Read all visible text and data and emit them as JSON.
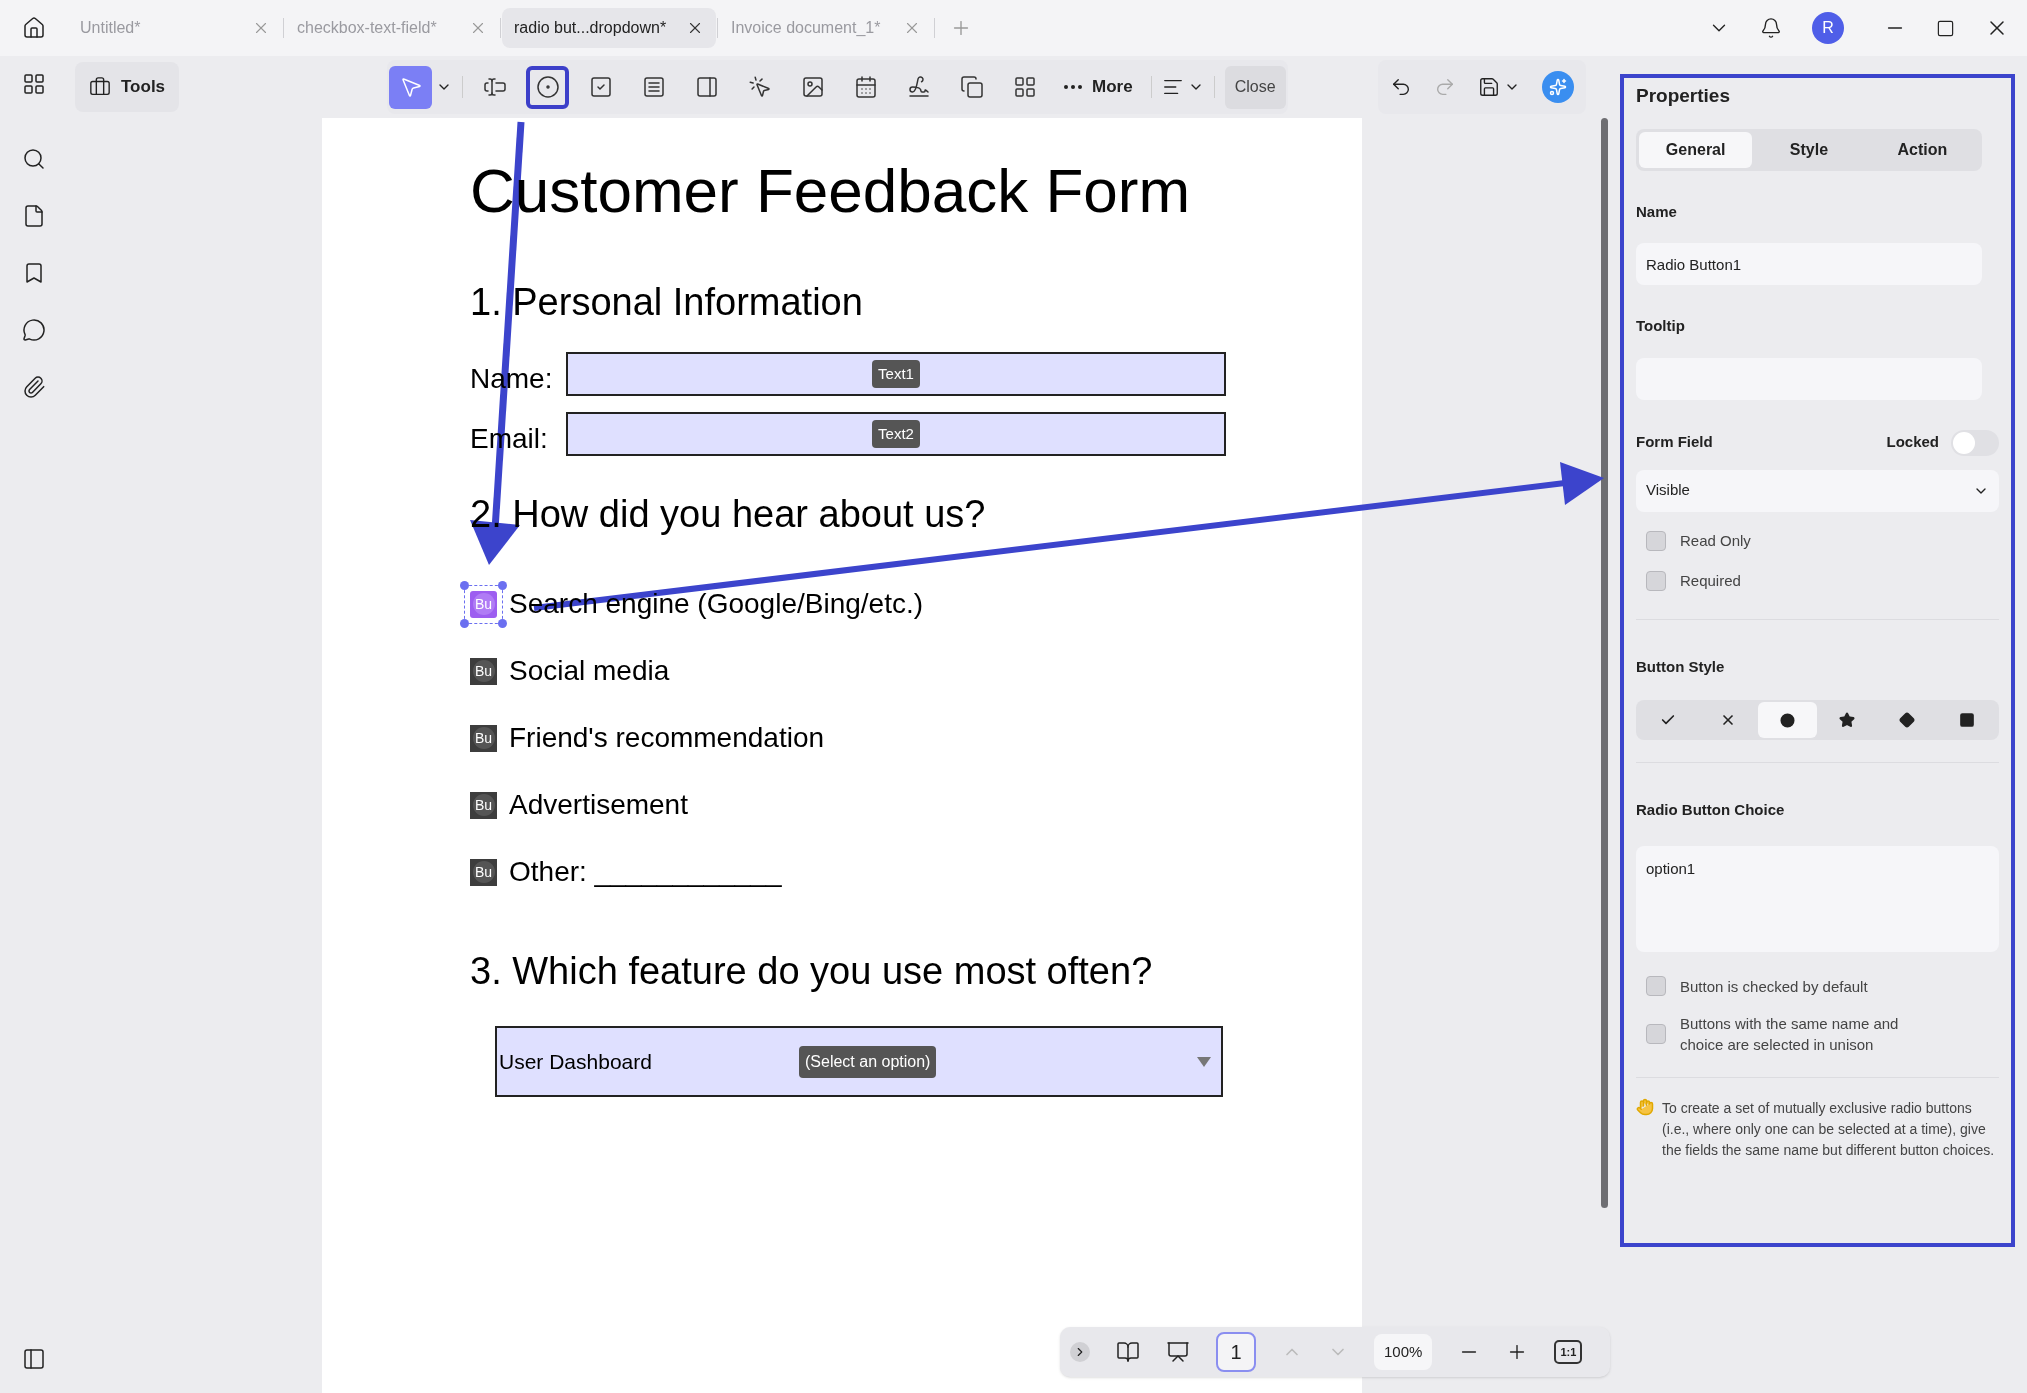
{
  "tabs": [
    {
      "label": "Untitled*",
      "selected": false
    },
    {
      "label": "checkbox-text-field*",
      "selected": false
    },
    {
      "label": "radio but...dropdown*",
      "selected": true
    },
    {
      "label": "Invoice document_1*",
      "selected": false
    }
  ],
  "avatar": "R",
  "toolbar": {
    "tools_label": "Tools",
    "more_label": "More",
    "close_label": "Close",
    "tools": [
      {
        "kind": "select",
        "selected": true,
        "highlighted": false
      },
      {
        "kind": "textfield",
        "selected": false,
        "highlighted": false
      },
      {
        "kind": "radio",
        "selected": false,
        "highlighted": true
      },
      {
        "kind": "checkbox",
        "selected": false,
        "highlighted": false
      },
      {
        "kind": "combo",
        "selected": false,
        "highlighted": false
      },
      {
        "kind": "list",
        "selected": false,
        "highlighted": false
      },
      {
        "kind": "button",
        "selected": false,
        "highlighted": false
      },
      {
        "kind": "image",
        "selected": false,
        "highlighted": false
      },
      {
        "kind": "date",
        "selected": false,
        "highlighted": false
      },
      {
        "kind": "signature",
        "selected": false,
        "highlighted": false
      },
      {
        "kind": "copy",
        "selected": false,
        "highlighted": false
      },
      {
        "kind": "grid",
        "selected": false,
        "highlighted": false
      }
    ]
  },
  "document": {
    "title": "Customer Feedback Form",
    "section_1": {
      "heading": "1. Personal Information",
      "fields": [
        {
          "label": "Name:",
          "tag": "Text1"
        },
        {
          "label": "Email:",
          "tag": "Text2"
        }
      ]
    },
    "section_2": {
      "heading": "2. How did you hear about us?",
      "options": [
        {
          "label": "Search engine (Google/Bing/etc.)",
          "widget": "Bu",
          "selected": true
        },
        {
          "label": "Social media",
          "widget": "Bu",
          "selected": false
        },
        {
          "label": "Friend's recommendation",
          "widget": "Bu",
          "selected": false
        },
        {
          "label": "Advertisement",
          "widget": "Bu",
          "selected": false
        },
        {
          "label": "Other: ____________",
          "widget": "Bu",
          "selected": false
        }
      ]
    },
    "section_3": {
      "heading": "3. Which feature do you use most often?",
      "dropdown": {
        "value": "User Dashboard",
        "tag": "(Select an option)"
      }
    }
  },
  "properties": {
    "title": "Properties",
    "tabs": [
      {
        "label": "General",
        "selected": true
      },
      {
        "label": "Style",
        "selected": false
      },
      {
        "label": "Action",
        "selected": false
      }
    ],
    "name": {
      "label": "Name",
      "value": "Radio Button1"
    },
    "tooltip": {
      "label": "Tooltip"
    },
    "form_field": {
      "label": "Form Field",
      "locked_label": "Locked",
      "locked": false,
      "visibility": "Visible",
      "options": [
        {
          "label": "Read Only",
          "checked": false
        },
        {
          "label": "Required",
          "checked": false
        }
      ]
    },
    "button_style": {
      "label": "Button Style",
      "styles": [
        {
          "kind": "check",
          "selected": false
        },
        {
          "kind": "cross",
          "selected": false
        },
        {
          "kind": "circle",
          "selected": true
        },
        {
          "kind": "star",
          "selected": false
        },
        {
          "kind": "diamond",
          "selected": false
        },
        {
          "kind": "square",
          "selected": false
        }
      ]
    },
    "choice": {
      "label": "Radio Button Choice",
      "value": "option1",
      "options": [
        {
          "label": "Button is checked by default",
          "checked": false
        },
        {
          "label": "Buttons with the same name and choice are selected in unison",
          "checked": false
        }
      ]
    },
    "hint": "To create a set of mutually exclusive radio buttons (i.e., where only one can be selected at a time), give the fields the same name but different button choices."
  },
  "bottom_bar": {
    "page": "1",
    "zoom": "100%",
    "fit_label": "1:1"
  }
}
